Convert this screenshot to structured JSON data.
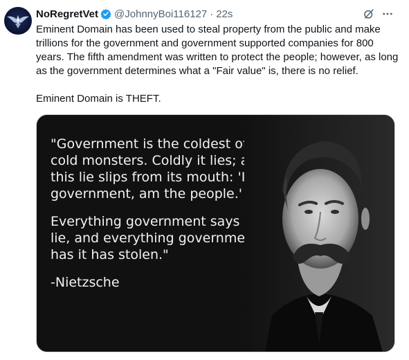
{
  "tweet": {
    "display_name": "NoRegretVet",
    "handle": "@JohnnyBoi116127",
    "separator": "·",
    "timestamp": "22s",
    "body_paragraph_1": "Eminent Domain has been used to steal property from the public and make trillions for the government and government supported companies for 800 years. The fifth amendment was written to protect the people; however, as long as the government determines what a \"Fair value\" is, there is no relief.",
    "body_paragraph_2": "Eminent Domain is THEFT.",
    "icons": {
      "avatar": "air-force-wings-logo",
      "verified": "verified-badge-icon",
      "grok": "grok-icon",
      "more": "more-icon"
    },
    "colors": {
      "verified": "#1d9bf0",
      "secondary_text": "#536471"
    }
  },
  "media": {
    "quote_line_1": "\"Government is the coldest of all cold monsters. Coldly it lies; and this lie slips from its mouth: 'I, government, am the people.'",
    "quote_line_2": "Everything government says is a lie, and everything government has it has stolen.\"",
    "attribution": "-Nietzsche"
  }
}
